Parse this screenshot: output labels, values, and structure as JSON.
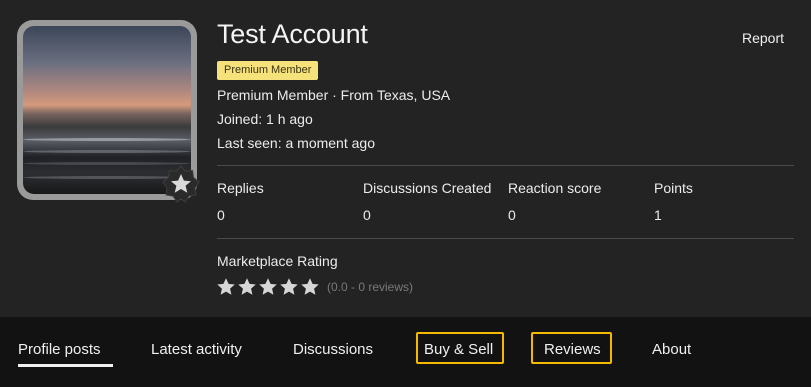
{
  "profile": {
    "name": "Test Account",
    "report_label": "Report",
    "badge": "Premium Member",
    "member_line": "Premium Member · From Texas, USA",
    "joined": "Joined: 1 h ago",
    "last_seen": "Last seen: a moment ago",
    "avatar_badge_icon": "star-icon"
  },
  "stats": [
    {
      "label": "Replies",
      "value": "0"
    },
    {
      "label": "Discussions Created",
      "value": "0"
    },
    {
      "label": "Reaction score",
      "value": "0"
    },
    {
      "label": "Points",
      "value": "1"
    }
  ],
  "marketplace": {
    "label": "Marketplace Rating",
    "rating": 0.0,
    "max_stars": 5,
    "rating_text": "(0.0 - 0 reviews)"
  },
  "tabs": [
    {
      "label": "Profile posts",
      "active": true
    },
    {
      "label": "Latest activity",
      "active": false
    },
    {
      "label": "Discussions",
      "active": false
    },
    {
      "label": "Buy & Sell",
      "active": false,
      "highlighted": true
    },
    {
      "label": "Reviews",
      "active": false,
      "highlighted": true
    },
    {
      "label": "About",
      "active": false
    }
  ],
  "colors": {
    "background": "#232323",
    "tab_bar": "#121212",
    "badge": "#f6e27a",
    "highlight_outline": "#f5b800",
    "star": "#d6d6d6"
  }
}
